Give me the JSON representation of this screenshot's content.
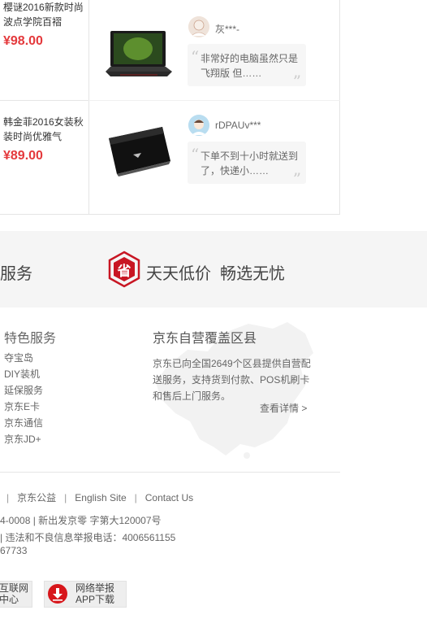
{
  "products": [
    {
      "name": "樱谜2016新款时尚波点学院百褶",
      "price": "¥98.00"
    },
    {
      "name": "韩金菲2016女装秋装时尚优雅气",
      "price": "¥89.00"
    }
  ],
  "reviews": [
    {
      "username": "灰***-",
      "comment": "非常好的电脑虽然只是飞翔版 但……",
      "image_icon": "laptop-icon"
    },
    {
      "username": "rDPAUv***",
      "comment": "下单不到十小时就送到了，快递小……",
      "image_icon": "wallet-icon"
    }
  ],
  "promise": {
    "left_text": "服务",
    "badge_char": "省",
    "slogan": "天天低价  畅选无忧"
  },
  "special_services": {
    "title": "特色服务",
    "links": [
      "夺宝岛",
      "DIY装机",
      "延保服务",
      "京东E卡",
      "京东通信",
      "京东JD+"
    ]
  },
  "coverage": {
    "title": "京东自营覆盖区县",
    "description": "京东已向全国2649个区县提供自营配送服务，支持货到付款、POS机刷卡和售后上门服务。",
    "more": "查看详情 >"
  },
  "footer": {
    "links": [
      "京东公益",
      "English Site",
      "Contact Us"
    ],
    "line1": "4-0008 | 新出发京零 字第大120007号",
    "line2": "| 违法和不良信息举报电话：4006561155",
    "line3": "67733"
  },
  "badges": [
    {
      "line1": "互联网",
      "line2": "中心"
    },
    {
      "line1": "网络举报",
      "line2": "APP下载"
    }
  ],
  "colors": {
    "price": "#e4393c",
    "brand_red": "#c81623"
  }
}
